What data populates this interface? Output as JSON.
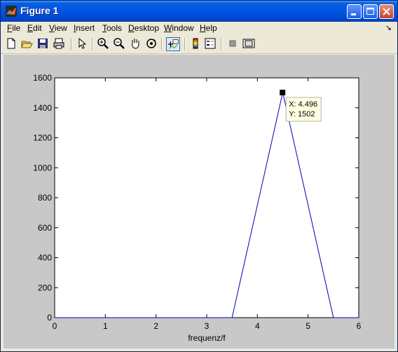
{
  "window": {
    "title": "Figure 1"
  },
  "menu": [
    {
      "pre": "",
      "u": "F",
      "post": "ile"
    },
    {
      "pre": "",
      "u": "E",
      "post": "dit"
    },
    {
      "pre": "",
      "u": "V",
      "post": "iew"
    },
    {
      "pre": "",
      "u": "I",
      "post": "nsert"
    },
    {
      "pre": "",
      "u": "T",
      "post": "ools"
    },
    {
      "pre": "",
      "u": "D",
      "post": "esktop"
    },
    {
      "pre": "",
      "u": "W",
      "post": "indow"
    },
    {
      "pre": "",
      "u": "H",
      "post": "elp"
    }
  ],
  "toolbar": {
    "icons": [
      "new-figure-icon",
      "open-file-icon",
      "save-icon",
      "print-icon",
      "edit-plot-arrow-icon",
      "zoom-in-icon",
      "zoom-out-icon",
      "pan-hand-icon",
      "rotate-3d-icon",
      "data-cursor-icon",
      "colorbar-icon",
      "legend-icon",
      "hide-plot-tools-icon",
      "show-plot-tools-icon"
    ]
  },
  "chart_data": {
    "type": "line",
    "xlabel": "frequenz/f",
    "ylabel": "",
    "title": "",
    "xlim": [
      0,
      6
    ],
    "ylim": [
      0,
      1600
    ],
    "xticks": [
      "0",
      "1",
      "2",
      "3",
      "4",
      "5",
      "6"
    ],
    "yticks": [
      "0",
      "200",
      "400",
      "600",
      "800",
      "1000",
      "1200",
      "1400",
      "1600"
    ],
    "grid": false,
    "series": [
      {
        "color": "#0000b8",
        "x": [
          0,
          3.5,
          4.5,
          5.5,
          6
        ],
        "y": [
          0,
          0,
          1502,
          0,
          0
        ]
      }
    ],
    "datatip": {
      "x": 4.496,
      "y": 1502,
      "line1": "X: 4.496",
      "line2": "Y: 1502"
    }
  }
}
